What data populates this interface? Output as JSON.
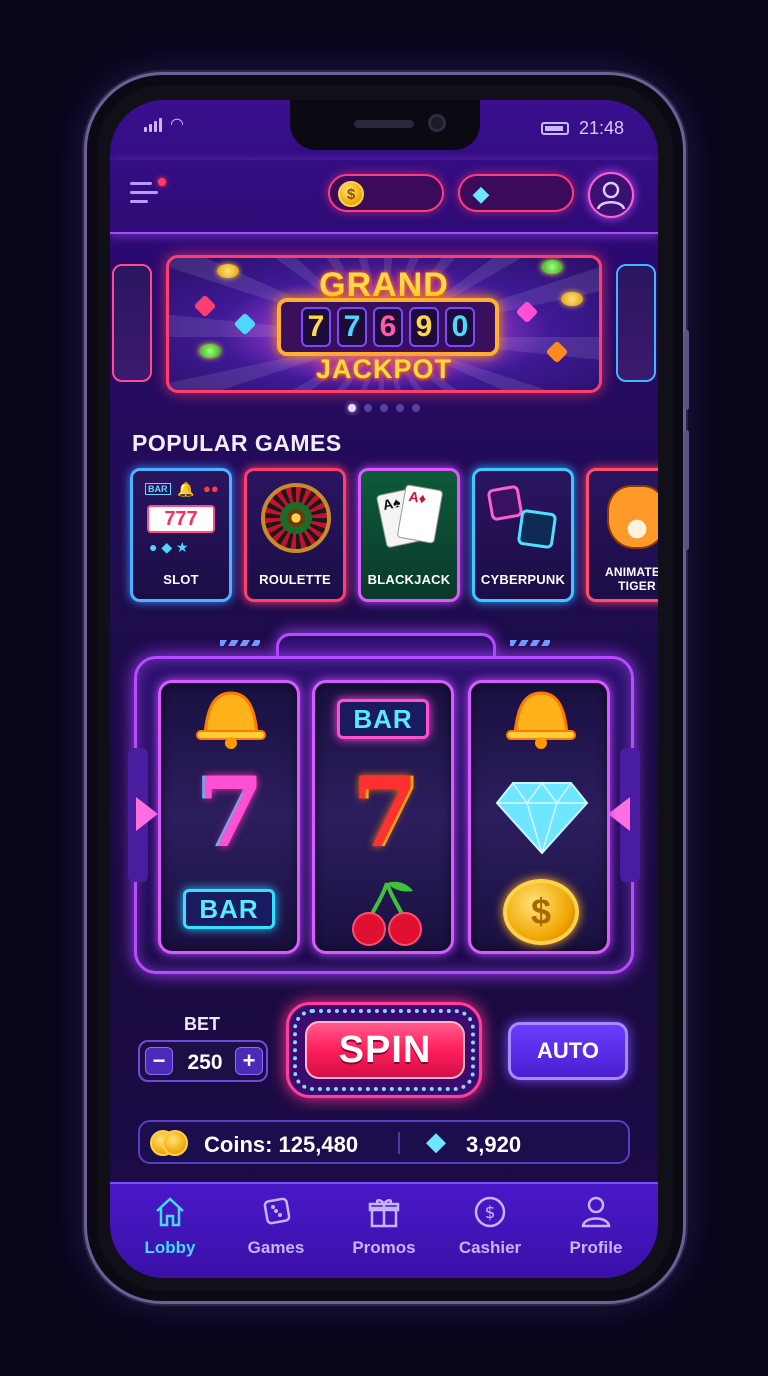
{
  "status": {
    "time": "21:48"
  },
  "header": {
    "coin_balance": "",
    "gem_balance": ""
  },
  "banner": {
    "title_top": "GRAND",
    "digits": [
      "7",
      "7",
      "6",
      "9",
      "0"
    ],
    "title_bottom": "JACKPOT"
  },
  "carousel": {
    "active_index": 0,
    "count": 5
  },
  "popular": {
    "title": "POPULAR GAMES",
    "games": [
      {
        "label": "SLOT",
        "art_text": "BAR"
      },
      {
        "label": "ROULETTE"
      },
      {
        "label": "BLACKJACK"
      },
      {
        "label": "CYBERPUNK"
      },
      {
        "label": "ANIMATED TIGER"
      }
    ]
  },
  "slot_machine": {
    "reels": [
      {
        "symbols": [
          "bell",
          "7",
          "BAR"
        ]
      },
      {
        "symbols": [
          "BAR",
          "7",
          "cherry"
        ]
      },
      {
        "symbols": [
          "bell",
          "diamond",
          "coin"
        ]
      }
    ]
  },
  "controls": {
    "bet_label": "BET",
    "bet_value": "250",
    "decrement": "−",
    "increment": "+",
    "spin_label": "SPIN",
    "auto_label": "AUTO"
  },
  "balance": {
    "coins_text": "Coins: 125,480",
    "gems_value": "3,920"
  },
  "tabbar": {
    "items": [
      {
        "label": "Lobby",
        "icon": "home-icon",
        "active": true
      },
      {
        "label": "Games",
        "icon": "dice-icon",
        "active": false
      },
      {
        "label": "Promos",
        "icon": "gift-icon",
        "active": false
      },
      {
        "label": "Cashier",
        "icon": "dollar-coin-icon",
        "active": false
      },
      {
        "label": "Profile",
        "icon": "person-icon",
        "active": false
      }
    ]
  },
  "colors": {
    "accent_pink": "#ff3d6e",
    "accent_purple": "#b84bff",
    "accent_cyan": "#46d8ff",
    "gold": "#ffd84a"
  }
}
